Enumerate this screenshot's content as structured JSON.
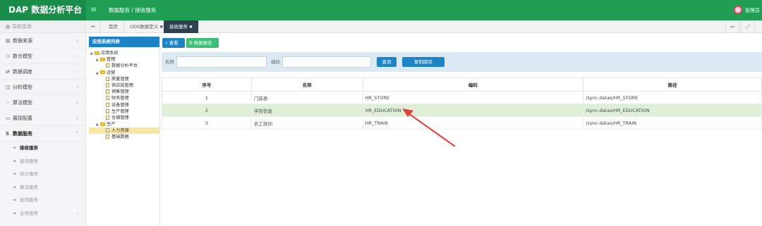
{
  "header": {
    "brand": "DAP 数据分析平台",
    "menu_toggle": "≡",
    "breadcrumb": "数据服务 / 接收服务",
    "user_name": "管理员"
  },
  "sidebar": {
    "title": "导航菜单",
    "items": [
      {
        "icon": "database-icon",
        "glyph": "▤",
        "label": "数据来源",
        "chev": "‹"
      },
      {
        "icon": "model-icon",
        "glyph": "⚇",
        "label": "数仓模型",
        "chev": "‹"
      },
      {
        "icon": "schedule-icon",
        "glyph": "⇄",
        "label": "数据调度",
        "chev": "‹"
      },
      {
        "icon": "analysis-icon",
        "glyph": "◫",
        "label": "分析模型",
        "chev": "‹"
      },
      {
        "icon": "algorithm-icon",
        "glyph": "⁘",
        "label": "算法模型",
        "chev": "‹"
      },
      {
        "icon": "display-icon",
        "glyph": "▭",
        "label": "展现配置",
        "chev": "‹"
      },
      {
        "icon": "service-icon",
        "glyph": "S",
        "label": "数据服务",
        "chev": "ˇ"
      }
    ],
    "sub_items": [
      {
        "label": "接收服务"
      },
      {
        "label": "查询服务"
      },
      {
        "label": "统计服务"
      },
      {
        "label": "算法服务"
      },
      {
        "label": "批同服务"
      },
      {
        "label": "业务服务",
        "chev": "‹"
      }
    ]
  },
  "tabs": {
    "back": "⏮",
    "items": [
      "首页",
      "ODS数据定义",
      "接收服务"
    ],
    "forward": "⏭",
    "fullscreen": "⤢"
  },
  "tree": {
    "title": "应用系统列表",
    "nodes": [
      {
        "label": "应用系统",
        "level": 0,
        "type": "folder",
        "toggle": "▲"
      },
      {
        "label": "管理",
        "level": 1,
        "type": "folder",
        "toggle": "▲"
      },
      {
        "label": "数据分析平台",
        "level": 2,
        "type": "doc"
      },
      {
        "label": "运营",
        "level": 1,
        "type": "folder",
        "toggle": "▲"
      },
      {
        "label": "质量管理",
        "level": 2,
        "type": "doc"
      },
      {
        "label": "供应链管理",
        "level": 2,
        "type": "doc"
      },
      {
        "label": "销售管理",
        "level": 2,
        "type": "doc"
      },
      {
        "label": "财务管理",
        "level": 2,
        "type": "doc"
      },
      {
        "label": "设备管理",
        "level": 2,
        "type": "doc"
      },
      {
        "label": "生产管理",
        "level": 2,
        "type": "doc"
      },
      {
        "label": "仓储管理",
        "level": 2,
        "type": "doc"
      },
      {
        "label": "生产",
        "level": 1,
        "type": "folder",
        "toggle": "▲"
      },
      {
        "label": "人力资源",
        "level": 2,
        "type": "doc",
        "selected": true
      },
      {
        "label": "基础数据",
        "level": 2,
        "type": "doc"
      }
    ]
  },
  "toolbar": {
    "view_label": "查看",
    "export_label": "数据报告"
  },
  "filter": {
    "name_label": "名称",
    "name_value": "",
    "code_label": "编码",
    "code_value": "",
    "query_label": "查询",
    "copy_label": "复制路径"
  },
  "table": {
    "columns": [
      "序号",
      "名称",
      "编码",
      "路径"
    ],
    "rows": [
      [
        "1",
        "门店表",
        "HR_STORE",
        "/sync-datas/HR_STORE"
      ],
      [
        "2",
        "学历信息",
        "HR_EDUCATION",
        "/sync-datas/HR_EDUCATION"
      ],
      [
        "3",
        "员工培训",
        "HR_TRAIN",
        "/sync-datas/HR_TRAIN"
      ]
    ],
    "highlighted_row": 1
  },
  "colors": {
    "header_green": "#1f9e54",
    "primary_blue": "#1c84c6",
    "export_green": "#3bbf74",
    "arrow_red": "#e0403a",
    "row_highlight": "#e0f0d8"
  }
}
